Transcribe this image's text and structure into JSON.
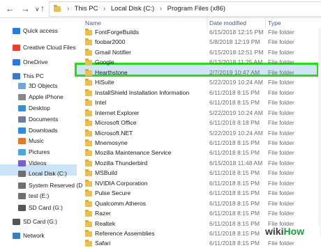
{
  "address": {
    "breadcrumbs": [
      "This PC",
      "Local Disk (C:)",
      "Program Files (x86)"
    ],
    "back_icon": "arrow-left-icon",
    "forward_icon": "arrow-right-icon",
    "recent_icon": "chevron-down-icon",
    "up_icon": "arrow-up-icon"
  },
  "columns": {
    "name": "Name",
    "date": "Date modified",
    "type": "Type"
  },
  "sidebar": {
    "items": [
      {
        "label": "Quick access",
        "icon": "star-icon"
      },
      {
        "label": "Creative Cloud Files",
        "icon": "creative-cloud-icon"
      },
      {
        "label": "OneDrive",
        "icon": "cloud-icon"
      },
      {
        "label": "This PC",
        "icon": "computer-icon"
      },
      {
        "label": "3D Objects",
        "icon": "cube-icon"
      },
      {
        "label": "Apple iPhone",
        "icon": "phone-icon"
      },
      {
        "label": "Desktop",
        "icon": "desktop-icon"
      },
      {
        "label": "Documents",
        "icon": "document-icon"
      },
      {
        "label": "Downloads",
        "icon": "download-icon"
      },
      {
        "label": "Music",
        "icon": "music-icon"
      },
      {
        "label": "Pictures",
        "icon": "picture-icon"
      },
      {
        "label": "Videos",
        "icon": "video-icon"
      },
      {
        "label": "Local Disk (C:)",
        "icon": "drive-icon"
      },
      {
        "label": "System Reserved (D",
        "icon": "drive-icon"
      },
      {
        "label": "test (E:)",
        "icon": "drive-icon"
      },
      {
        "label": "SD Card (G:)",
        "icon": "sd-card-icon"
      },
      {
        "label": "SD Card (G:)",
        "icon": "sd-card-icon"
      },
      {
        "label": "Network",
        "icon": "network-icon"
      }
    ]
  },
  "files": [
    {
      "name": "FontForgeBuilds",
      "date": "6/15/2018 12:15 PM",
      "type": "File folder"
    },
    {
      "name": "foobar2000",
      "date": "5/8/2018 12:19 PM",
      "type": "File folder"
    },
    {
      "name": "Gmail Notifier",
      "date": "6/15/2018 12:51 PM",
      "type": "File folder"
    },
    {
      "name": "Google",
      "date": "6/13/2018 11:25 AM",
      "type": "File folder"
    },
    {
      "name": "Hearthstone",
      "date": "2/7/2019 10:47 AM",
      "type": "File folder"
    },
    {
      "name": "HiSuite",
      "date": "5/22/2019 10:24 AM",
      "type": "File folder"
    },
    {
      "name": "InstallShield Installation Information",
      "date": "6/11/2018 8:15 PM",
      "type": "File folder"
    },
    {
      "name": "Intel",
      "date": "6/11/2018 8:15 PM",
      "type": "File folder"
    },
    {
      "name": "Internet Explorer",
      "date": "5/22/2019 10:24 AM",
      "type": "File folder"
    },
    {
      "name": "Microsoft Office",
      "date": "6/11/2018 8:18 PM",
      "type": "File folder"
    },
    {
      "name": "Microsoft.NET",
      "date": "5/22/2019 10:24 AM",
      "type": "File folder"
    },
    {
      "name": "Mnemosyne",
      "date": "6/11/2018 8:15 PM",
      "type": "File folder"
    },
    {
      "name": "Mozilla Maintenance Service",
      "date": "6/11/2018 8:15 PM",
      "type": "File folder"
    },
    {
      "name": "Mozilla Thunderbird",
      "date": "6/15/2018 11:48 AM",
      "type": "File folder"
    },
    {
      "name": "MSBuild",
      "date": "6/11/2018 8:15 PM",
      "type": "File folder"
    },
    {
      "name": "NVIDIA Corporation",
      "date": "6/11/2018 8:15 PM",
      "type": "File folder"
    },
    {
      "name": "Pulse Secure",
      "date": "6/11/2018 8:15 PM",
      "type": "File folder"
    },
    {
      "name": "Qualcomm Atheros",
      "date": "6/11/2018 8:15 PM",
      "type": "File folder"
    },
    {
      "name": "Razer",
      "date": "6/11/2018 8:15 PM",
      "type": "File folder"
    },
    {
      "name": "Realtek",
      "date": "6/11/2018 8:15 PM",
      "type": "File folder"
    },
    {
      "name": "Reference Assemblies",
      "date": "6/11/2018 8:15 PM",
      "type": "File folder"
    },
    {
      "name": "Safari",
      "date": "6/11/2018 8:15 PM",
      "type": "File folder"
    }
  ],
  "selected_file": "Hearthstone",
  "selected_nav": "Local Disk (C:)",
  "watermark": {
    "prefix": "wiki",
    "suffix": "How"
  },
  "colors": {
    "highlight_border": "#27dd16",
    "selection": "#cce4f7",
    "folder": "#e8c054"
  }
}
